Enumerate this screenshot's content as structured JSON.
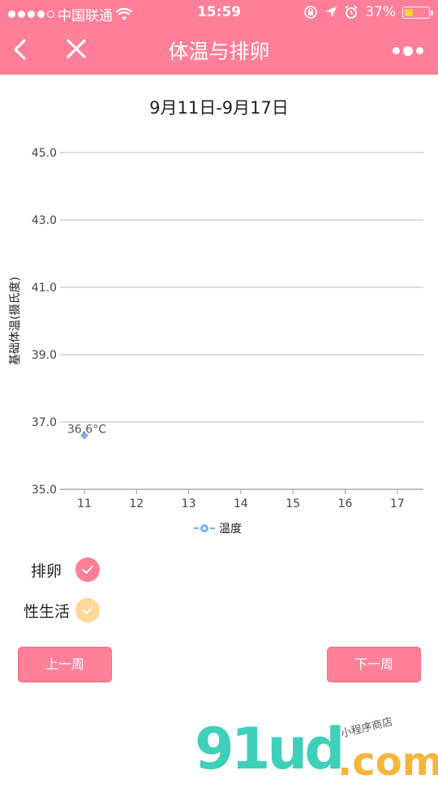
{
  "status_bar": {
    "carrier": "中国联通",
    "time": "15:59",
    "battery": "37%",
    "battery_level": 0.37
  },
  "nav": {
    "title": "体温与排卵"
  },
  "date_range": "9月11日-9月17日",
  "chart_data": {
    "type": "line",
    "categories": [
      "11",
      "12",
      "13",
      "14",
      "15",
      "16",
      "17"
    ],
    "ylabel": "基础体温(摄氏度)",
    "yticks": [
      "35.0",
      "37.0",
      "39.0",
      "41.0",
      "43.0",
      "45.0"
    ],
    "ylim": [
      35,
      45
    ],
    "grid": true,
    "legend": "bottom",
    "series": [
      {
        "name": "温度",
        "values": [
          36.6,
          null,
          null,
          null,
          null,
          null,
          null
        ],
        "color": "#7aaef0"
      }
    ],
    "annotations": [
      {
        "x": "11",
        "text": "36.6°C"
      }
    ]
  },
  "legend_items": {
    "ovulation": {
      "label": "排卵",
      "color": "#ff7f98"
    },
    "intercourse": {
      "label": "性生活",
      "color": "#ffd79a"
    }
  },
  "buttons": {
    "prev_week": "上一周",
    "next_week": "下一周"
  },
  "watermark": {
    "brand": "91ud",
    "suffix": ".com",
    "tagline": "小程序商店"
  }
}
